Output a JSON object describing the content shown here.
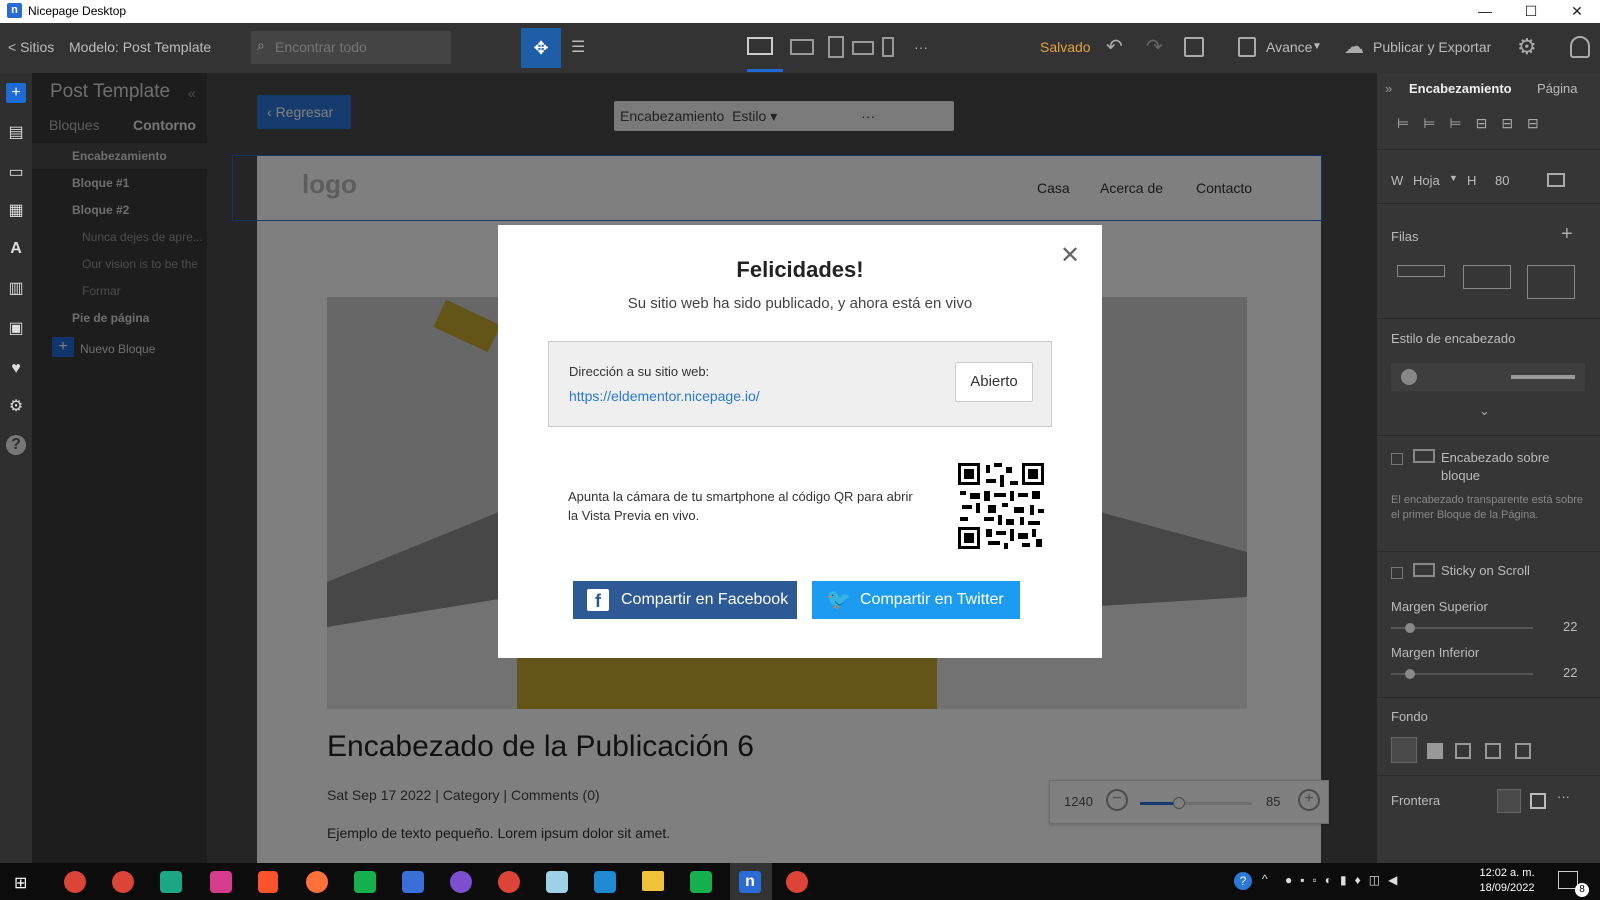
{
  "window": {
    "title": "Nicepage Desktop",
    "app_letter": "n"
  },
  "toolbar": {
    "back_label": "< Sitios",
    "model_label": "Modelo: Post Template",
    "search_placeholder": "Encontrar todo",
    "status_label": "Salvado",
    "preview_label": "Avance",
    "publish_label": "Publicar y Exportar",
    "more_label": "···"
  },
  "layers_panel": {
    "title": "Post Template",
    "tabs": [
      "Bloques",
      "Contorno"
    ],
    "items": [
      {
        "label": "Encabezamiento",
        "bold": true
      },
      {
        "label": "Bloque #1",
        "bold": true
      },
      {
        "label": "Bloque #2",
        "bold": true
      },
      {
        "label": "Nunca dejes de apre...",
        "bold": false
      },
      {
        "label": "Our vision is to be the",
        "bold": false
      },
      {
        "label": "Formar",
        "bold": false
      },
      {
        "label": "Pie de página",
        "bold": true
      },
      {
        "label": "Nuevo Bloque",
        "bold": false
      }
    ]
  },
  "canvas": {
    "back_button": "Regresar",
    "block_toolbar": {
      "section_label": "Encabezamiento",
      "style_label": "Estilo",
      "more": "···"
    },
    "header": {
      "logo": "logo",
      "nav": [
        "Casa",
        "Acerca de",
        "Contacto"
      ]
    },
    "post_title": "Encabezado de la Publicación 6",
    "meta": {
      "date": "Sat Sep 17 2022",
      "category": "Category",
      "comments": "Comments (0)"
    },
    "excerpt": "Ejemplo de texto pequeño. Lorem ipsum dolor sit amet.",
    "zoom": {
      "width": "1240",
      "value": "85",
      "fill_fraction": 0.35
    }
  },
  "modal": {
    "title": "Felicidades!",
    "subtitle": "Su sitio web ha sido publicado, y ahora está en vivo",
    "address_label": "Dirección a su sitio web:",
    "url": "https://eldementor.nicepage.io/",
    "open_button": "Abierto",
    "qr_text": "Apunta la cámara de tu smartphone al código QR para abrir la Vista Previa en vivo.",
    "facebook_button": "Compartir en Facebook",
    "twitter_button": "Compartir en Twitter",
    "facebook_color": "#2d5a94",
    "twitter_color": "#1d9bf0"
  },
  "right_panel": {
    "tabs": [
      "Encabezamiento",
      "Página"
    ],
    "width_label": "W",
    "width_value": "Hoja",
    "height_label": "H",
    "height_value": "80",
    "rows_label": "Filas",
    "header_style_label": "Estilo de encabezado",
    "over_block_label": "Encabezado sobre bloque",
    "over_block_desc": "El encabezado transparente está sobre el primer Bloque de la Página.",
    "sticky_label": "Sticky on Scroll",
    "margin_top_label": "Margen Superior",
    "margin_top_value": "22",
    "margin_bottom_label": "Margen Inferior",
    "margin_bottom_value": "22",
    "background_label": "Fondo",
    "border_label": "Frontera"
  },
  "taskbar": {
    "time": "12:02 a. m.",
    "date": "18/09/2022",
    "notif_count": "8"
  }
}
